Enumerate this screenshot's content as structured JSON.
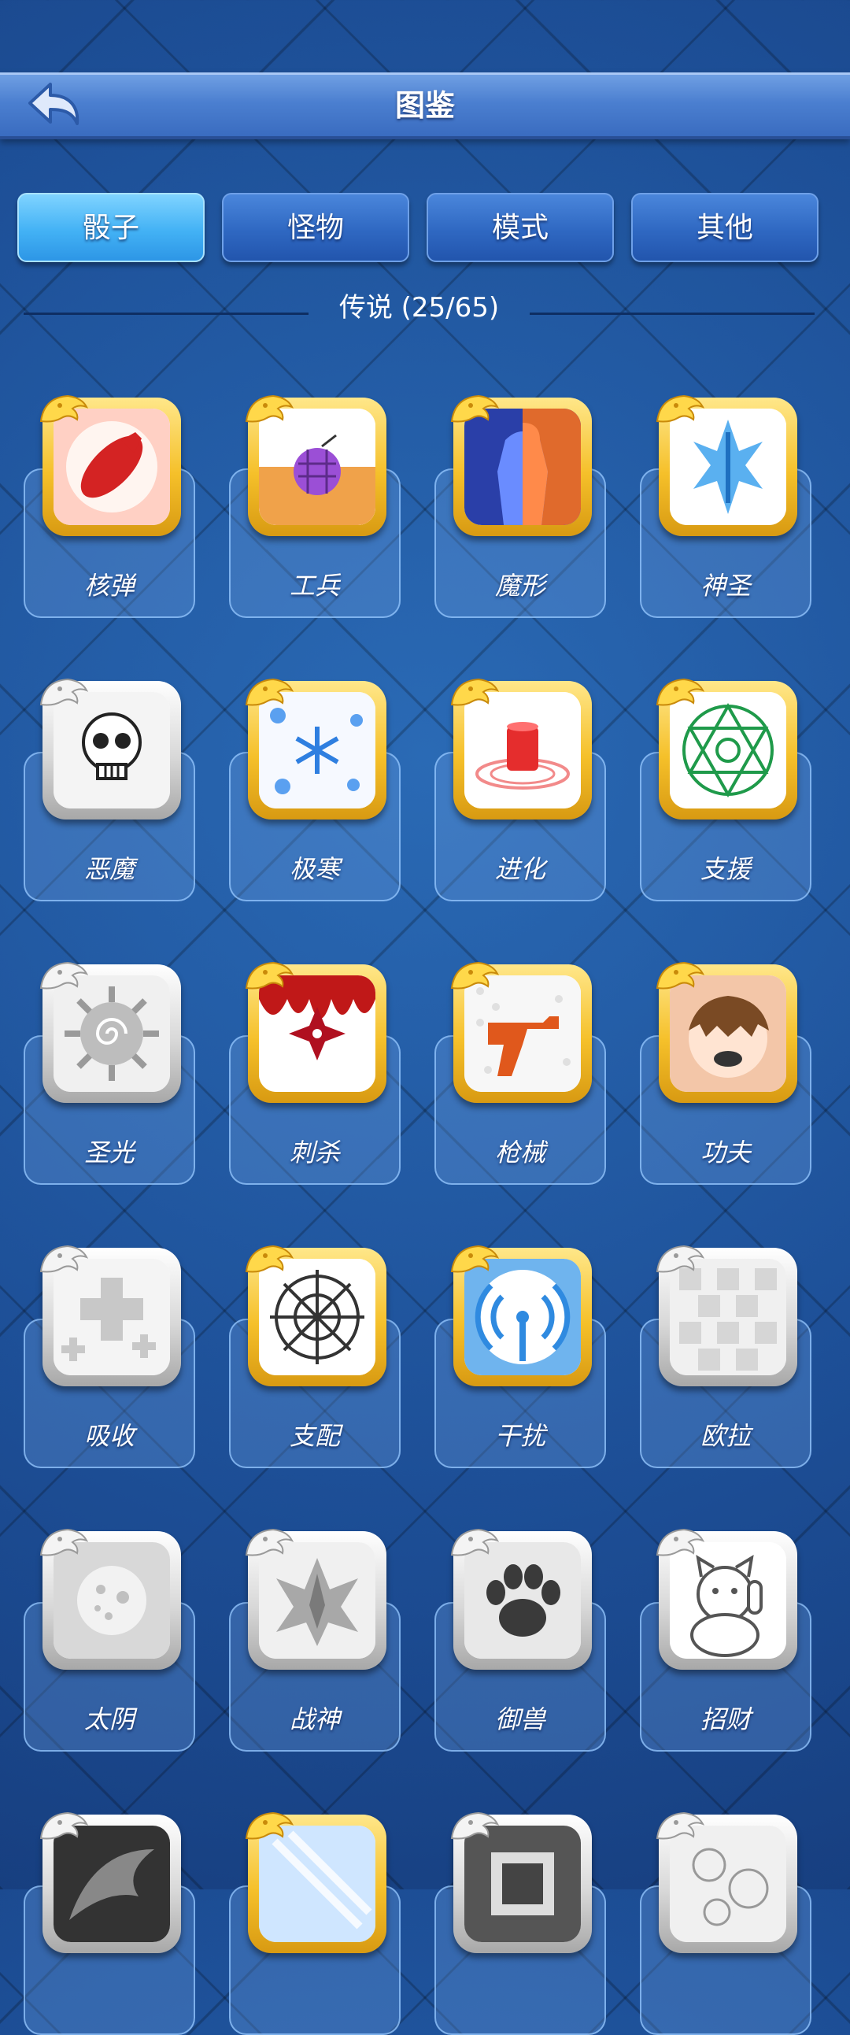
{
  "header": {
    "title": "图鉴",
    "back_icon": "back-arrow-icon"
  },
  "tabs": [
    {
      "label": "骰子",
      "active": true
    },
    {
      "label": "怪物",
      "active": false
    },
    {
      "label": "模式",
      "active": false
    },
    {
      "label": "其他",
      "active": false
    }
  ],
  "section": {
    "label": "传说 (25/65)"
  },
  "items": [
    {
      "name": "核弹",
      "icon": "nuke-icon",
      "unlocked": true
    },
    {
      "name": "工兵",
      "icon": "grenade-icon",
      "unlocked": true
    },
    {
      "name": "魔形",
      "icon": "shapeshifter-icon",
      "unlocked": true
    },
    {
      "name": "神圣",
      "icon": "holy-sword-icon",
      "unlocked": true
    },
    {
      "name": "恶魔",
      "icon": "skull-icon",
      "unlocked": false
    },
    {
      "name": "极寒",
      "icon": "snowflake-icon",
      "unlocked": true
    },
    {
      "name": "进化",
      "icon": "evolution-icon",
      "unlocked": true
    },
    {
      "name": "支援",
      "icon": "magic-circle-icon",
      "unlocked": true
    },
    {
      "name": "圣光",
      "icon": "sun-spiral-icon",
      "unlocked": false
    },
    {
      "name": "刺杀",
      "icon": "shuriken-blood-icon",
      "unlocked": true
    },
    {
      "name": "枪械",
      "icon": "revolver-icon",
      "unlocked": true
    },
    {
      "name": "功夫",
      "icon": "kungfu-icon",
      "unlocked": true
    },
    {
      "name": "吸收",
      "icon": "plus-burst-icon",
      "unlocked": false
    },
    {
      "name": "支配",
      "icon": "thorn-web-icon",
      "unlocked": true
    },
    {
      "name": "干扰",
      "icon": "signal-icon",
      "unlocked": true
    },
    {
      "name": "欧拉",
      "icon": "pixel-grid-icon",
      "unlocked": false
    },
    {
      "name": "太阴",
      "icon": "moon-icon",
      "unlocked": false
    },
    {
      "name": "战神",
      "icon": "war-god-icon",
      "unlocked": false
    },
    {
      "name": "御兽",
      "icon": "paw-icon",
      "unlocked": false
    },
    {
      "name": "招财",
      "icon": "lucky-cat-icon",
      "unlocked": false
    },
    {
      "name": "",
      "icon": "dragon-dark-icon",
      "unlocked": false
    },
    {
      "name": "",
      "icon": "mirror-icon",
      "unlocked": true
    },
    {
      "name": "",
      "icon": "dark-box-icon",
      "unlocked": false
    },
    {
      "name": "",
      "icon": "floral-icon",
      "unlocked": false
    }
  ],
  "colors": {
    "background": "#1d4f97",
    "tab_active": "#43b2f5",
    "tab_inactive": "#2f68c2",
    "gold_frame": "#f5c02a",
    "silver_frame": "#d8d8d8"
  }
}
